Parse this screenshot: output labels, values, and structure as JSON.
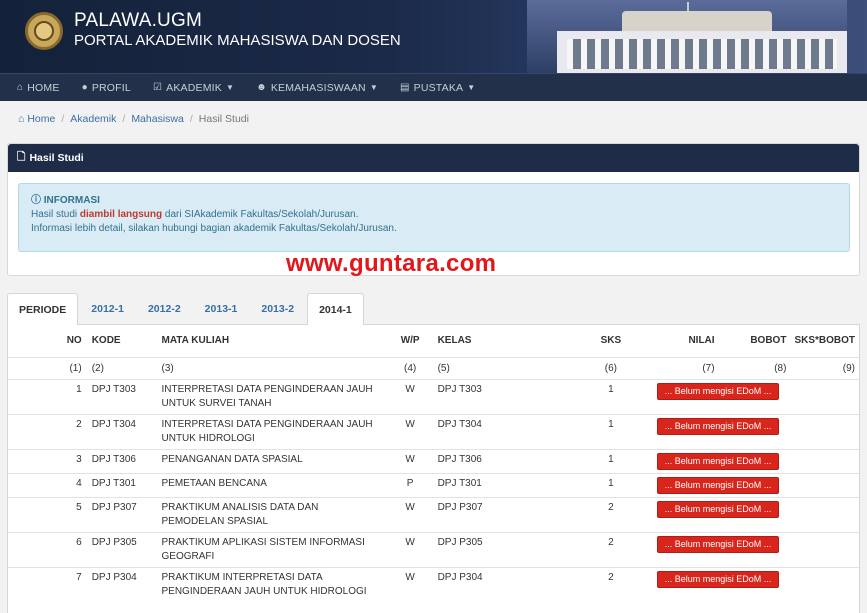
{
  "header": {
    "title": "PALAWA.UGM",
    "subtitle": "PORTAL AKADEMIK MAHASISWA DAN DOSEN"
  },
  "nav": {
    "items": [
      {
        "label": "HOME",
        "icon": "home-icon"
      },
      {
        "label": "PROFIL",
        "icon": "user-icon"
      },
      {
        "label": "AKADEMIK",
        "icon": "edit-icon",
        "dropdown": true
      },
      {
        "label": "KEMAHASISWAAN",
        "icon": "users-icon",
        "dropdown": true
      },
      {
        "label": "PUSTAKA",
        "icon": "book-icon",
        "dropdown": true
      }
    ]
  },
  "breadcrumb": [
    "Home",
    "Akademik",
    "Mahasiswa",
    "Hasil Studi"
  ],
  "panel": {
    "title": "Hasil Studi",
    "alert_title": "INFORMASI",
    "alert_line1_pre": "Hasil studi ",
    "alert_line1_bold": "diambil langsung",
    "alert_line1_post": " dari SIAkademik Fakultas/Sekolah/Jurusan.",
    "alert_line2": "Informasi lebih detail, silakan hubungi bagian akademik Fakultas/Sekolah/Jurusan."
  },
  "watermark": "www.guntara.com",
  "tabs": [
    {
      "label": "PERIODE",
      "active": false
    },
    {
      "label": "2012-1",
      "active": false
    },
    {
      "label": "2012-2",
      "active": false
    },
    {
      "label": "2013-1",
      "active": false
    },
    {
      "label": "2013-2",
      "active": false
    },
    {
      "label": "2014-1",
      "active": true
    }
  ],
  "table": {
    "headers": {
      "no": "NO",
      "kode": "KODE",
      "mk": "MATA KULIAH",
      "wp": "W/P",
      "kelas": "KELAS",
      "sks": "SKS",
      "nilai": "NILAI",
      "bobot": "BOBOT",
      "sksb": "SKS*BOBOT"
    },
    "col_numbers": [
      "(1)",
      "(2)",
      "(3)",
      "(4)",
      "(5)",
      "(6)",
      "(7)",
      "(8)",
      "(9)"
    ],
    "status_label": "... Belum mengisi EDoM ...",
    "rows": [
      {
        "no": "1",
        "kode": "DPJ T303",
        "mk": "INTERPRETASI DATA PENGINDERAAN JAUH UNTUK SURVEI TANAH",
        "wp": "W",
        "kelas": "DPJ T303",
        "sks": "1"
      },
      {
        "no": "2",
        "kode": "DPJ T304",
        "mk": "INTERPRETASI DATA PENGINDERAAN JAUH UNTUK HIDROLOGI",
        "wp": "W",
        "kelas": "DPJ T304",
        "sks": "1"
      },
      {
        "no": "3",
        "kode": "DPJ T306",
        "mk": "PENANGANAN DATA SPASIAL",
        "wp": "W",
        "kelas": "DPJ T306",
        "sks": "1"
      },
      {
        "no": "4",
        "kode": "DPJ T301",
        "mk": "PEMETAAN BENCANA",
        "wp": "P",
        "kelas": "DPJ T301",
        "sks": "1"
      },
      {
        "no": "5",
        "kode": "DPJ P307",
        "mk": "PRAKTIKUM ANALISIS DATA DAN PEMODELAN SPASIAL",
        "wp": "W",
        "kelas": "DPJ P307",
        "sks": "2"
      },
      {
        "no": "6",
        "kode": "DPJ P305",
        "mk": "PRAKTIKUM APLIKASI SISTEM INFORMASI GEOGRAFI",
        "wp": "W",
        "kelas": "DPJ P305",
        "sks": "2"
      },
      {
        "no": "7",
        "kode": "DPJ P304",
        "mk": "PRAKTIKUM INTERPRETASI DATA PENGINDERAAN JAUH UNTUK HIDROLOGI",
        "wp": "W",
        "kelas": "DPJ P304",
        "sks": "2"
      }
    ]
  }
}
